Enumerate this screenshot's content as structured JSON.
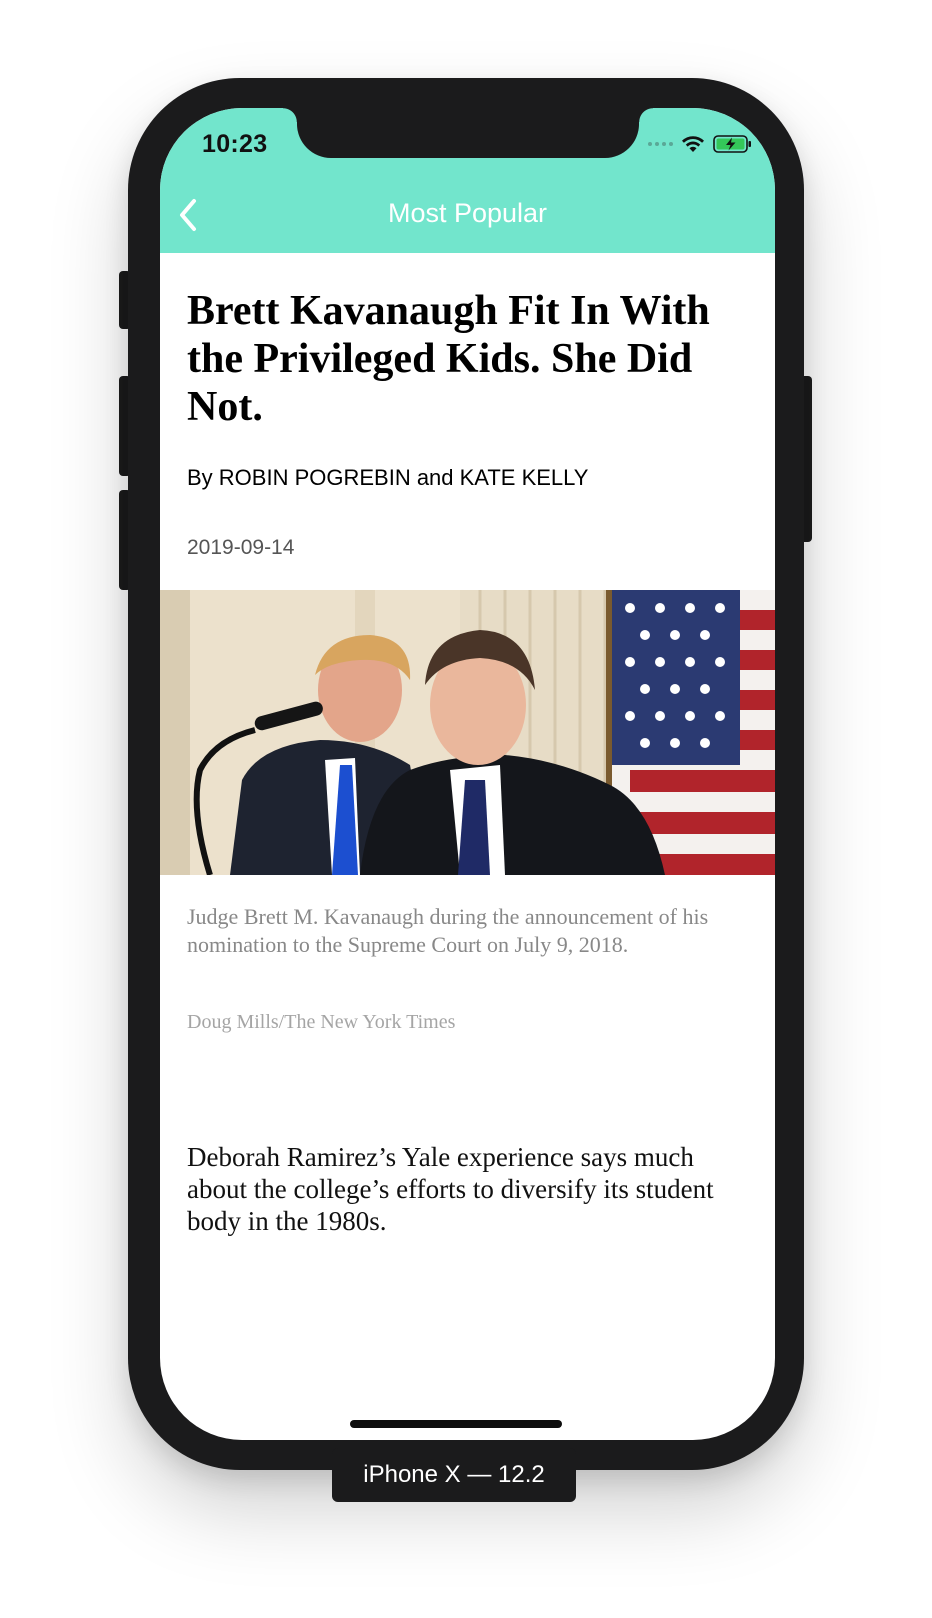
{
  "status_bar": {
    "time": "10:23",
    "wifi_icon": "wifi-icon",
    "battery_icon": "battery-charging-icon"
  },
  "nav": {
    "back_icon": "chevron-left-icon",
    "title": "Most Popular"
  },
  "article": {
    "headline": "Brett Kavanaugh Fit In With the Privileged Kids. She Did Not.",
    "byline": "By ROBIN POGREBIN and KATE KELLY",
    "date": "2019-09-14",
    "image_caption": "Judge Brett M. Kavanaugh during the announcement of his nomination to the Supreme Court on July 9, 2018.",
    "image_credit": "Doug Mills/The New York Times",
    "summary": "Deborah Ramirez’s Yale experience says much about the college’s efforts to diversify its student body in the 1980s."
  },
  "device_label": "iPhone X — 12.2",
  "colors": {
    "header_bg": "#72e5cc",
    "nav_title": "#ffffff",
    "device_frame": "#1b1b1c"
  }
}
